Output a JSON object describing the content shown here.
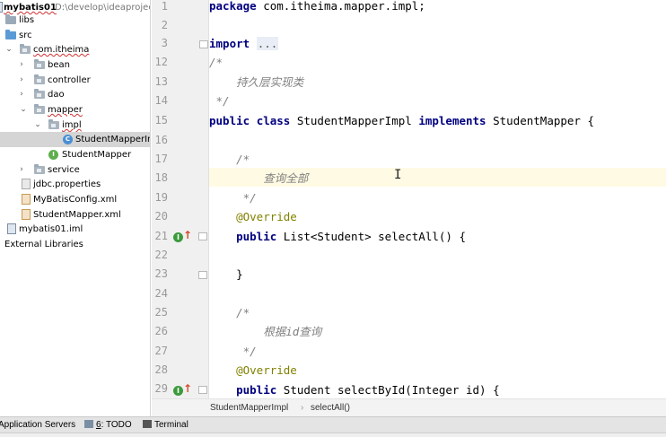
{
  "project_tree": {
    "root": {
      "name": "mybatis01",
      "path": "D:\\develop\\ideaproject"
    },
    "items": [
      {
        "label": "libs"
      },
      {
        "label": "src"
      },
      {
        "label": "com.itheima"
      },
      {
        "label": "bean"
      },
      {
        "label": "controller"
      },
      {
        "label": "dao"
      },
      {
        "label": "mapper"
      },
      {
        "label": "impl"
      },
      {
        "label": "StudentMapperIm"
      },
      {
        "label": "StudentMapper"
      },
      {
        "label": "service"
      },
      {
        "label": "jdbc.properties"
      },
      {
        "label": "MyBatisConfig.xml"
      },
      {
        "label": "StudentMapper.xml"
      },
      {
        "label": "mybatis01.iml"
      },
      {
        "label": "External Libraries"
      }
    ]
  },
  "editor": {
    "line_numbers": [
      "1",
      "2",
      "3",
      "12",
      "13",
      "14",
      "15",
      "16",
      "17",
      "18",
      "19",
      "20",
      "21",
      "22",
      "23",
      "24",
      "25",
      "26",
      "27",
      "28",
      "29"
    ],
    "code": {
      "l1_kw": "package",
      "l1_rest": " com.itheima.mapper.impl;",
      "l3_kw": "import",
      "l3_dots": "...",
      "l12": "/*",
      "l13": "    持久层实现类",
      "l14": " */",
      "l15_kw1": "public",
      "l15_kw2": "class",
      "l15_name": " StudentMapperImpl ",
      "l15_kw3": "implements",
      "l15_rest": " StudentMapper {",
      "l17": "    /*",
      "l18": "        查询全部",
      "l19": "     */",
      "l20": "    @Override",
      "l21_kw": "public",
      "l21_rest": " List<Student> selectAll() {",
      "l23": "    }",
      "l25": "    /*",
      "l26": "        根据id查询",
      "l27": "     */",
      "l28": "    @Override",
      "l29_kw": "public",
      "l29_rest": " Student selectById(Integer id) {"
    },
    "caret": "I"
  },
  "breadcrumb": {
    "class": "StudentMapperImpl",
    "separator": "›",
    "method": "selectAll()"
  },
  "bottom_bar": {
    "app_servers": "Application Servers",
    "todo_num": "6",
    "todo_label": ": TODO",
    "terminal": "Terminal"
  },
  "colors": {
    "keyword": "#000080",
    "comment": "#808080",
    "annotation": "#808000",
    "current_line": "#fffae3",
    "selection": "#d5d5d5"
  }
}
